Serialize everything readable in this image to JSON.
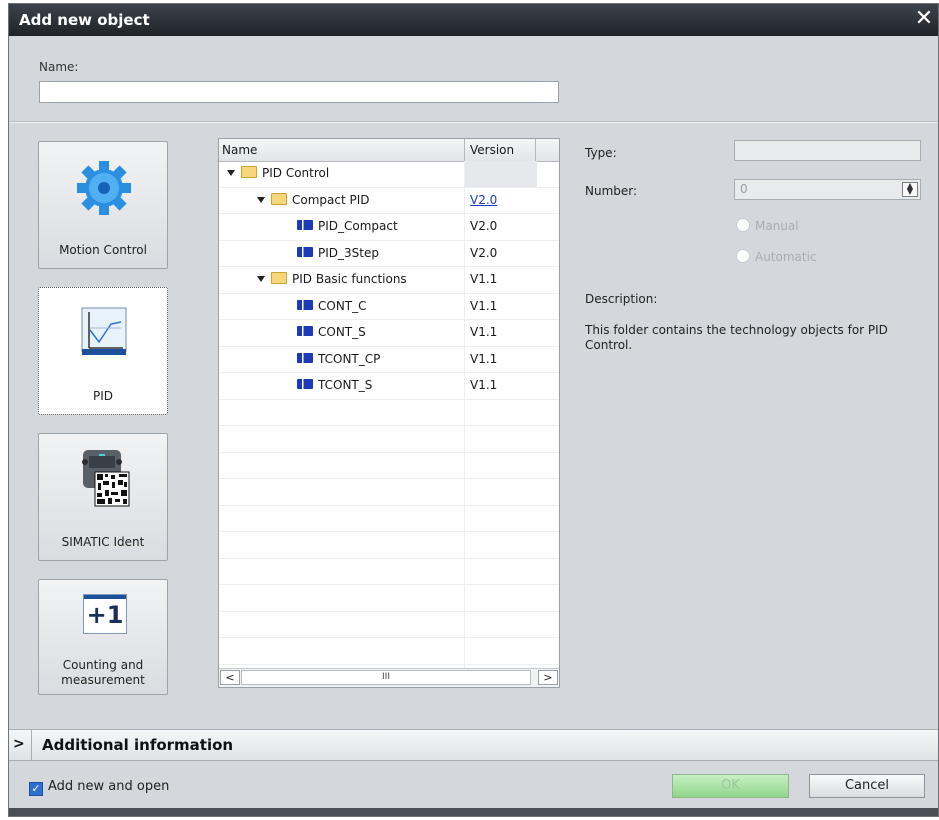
{
  "dialog": {
    "title": "Add new object",
    "close_glyph": "✕"
  },
  "name": {
    "label": "Name:",
    "value": ""
  },
  "categories": [
    {
      "label": "Motion Control",
      "icon": "gear-icon",
      "selected": false
    },
    {
      "label": "PID",
      "icon": "chart-icon",
      "selected": true
    },
    {
      "label": "SIMATIC Ident",
      "icon": "rfid-reader-icon",
      "selected": false
    },
    {
      "label": "Counting and measurement",
      "icon": "counter-icon",
      "selected": false,
      "icon_text": "+1"
    }
  ],
  "tree": {
    "columns": [
      "Name",
      "Version"
    ],
    "rows": [
      {
        "name": "PID Control",
        "version": "",
        "kind": "folder",
        "level": 0,
        "expanded": true
      },
      {
        "name": "Compact PID",
        "version": "V2.0",
        "kind": "folder",
        "level": 1,
        "expanded": true,
        "version_link": true
      },
      {
        "name": "PID_Compact",
        "version": "V2.0",
        "kind": "object",
        "level": 2
      },
      {
        "name": "PID_3Step",
        "version": "V2.0",
        "kind": "object",
        "level": 2
      },
      {
        "name": "PID Basic functions",
        "version": "V1.1",
        "kind": "folder",
        "level": 1,
        "expanded": true
      },
      {
        "name": "CONT_C",
        "version": "V1.1",
        "kind": "object",
        "level": 2
      },
      {
        "name": "CONT_S",
        "version": "V1.1",
        "kind": "object",
        "level": 2
      },
      {
        "name": "TCONT_CP",
        "version": "V1.1",
        "kind": "object",
        "level": 2
      },
      {
        "name": "TCONT_S",
        "version": "V1.1",
        "kind": "object",
        "level": 2
      }
    ],
    "scroll_left": "<",
    "scroll_right": ">",
    "scroll_thumb": "III"
  },
  "details": {
    "type_label": "Type:",
    "type_value": "",
    "number_label": "Number:",
    "number_value": "0",
    "radio_manual": "Manual",
    "radio_automatic": "Automatic",
    "description_label": "Description:",
    "description_text": "This folder contains the technology objects for PID Control."
  },
  "additional_info": {
    "chevron": ">",
    "label": "Additional information"
  },
  "footer": {
    "checkbox_label": "Add new and open",
    "checkbox_checked": true,
    "ok_label": "OK",
    "cancel_label": "Cancel"
  }
}
